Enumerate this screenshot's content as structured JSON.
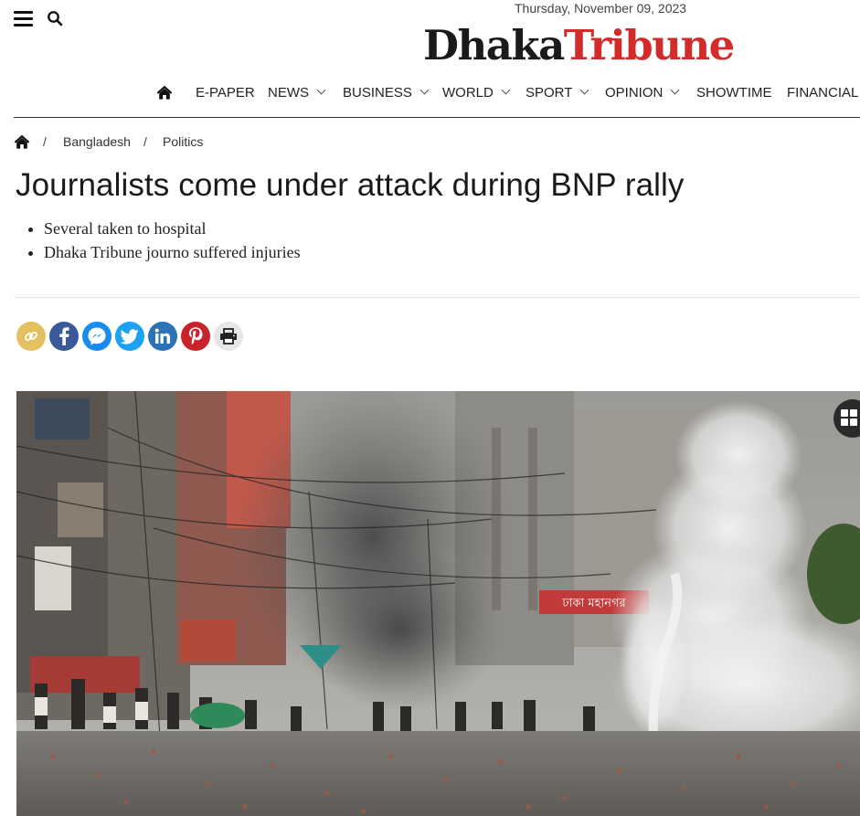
{
  "header": {
    "date": "Thursday, November 09, 2023",
    "logo_part1": "Dhaka",
    "logo_part2": "Tribune",
    "menu_icon": "hamburger-menu-icon",
    "search_icon": "search-icon"
  },
  "nav": {
    "home_icon": "home-icon",
    "items": [
      {
        "label": "E-PAPER",
        "dropdown": false
      },
      {
        "label": "NEWS",
        "dropdown": true
      },
      {
        "label": "BUSINESS",
        "dropdown": true
      },
      {
        "label": "WORLD",
        "dropdown": true
      },
      {
        "label": "SPORT",
        "dropdown": true
      },
      {
        "label": "OPINION",
        "dropdown": true
      },
      {
        "label": "SHOWTIME",
        "dropdown": false
      },
      {
        "label": "FINANCIAL",
        "dropdown": false
      }
    ]
  },
  "breadcrumb": {
    "separator": "/",
    "items": [
      "Bangladesh",
      "Politics"
    ]
  },
  "article": {
    "headline": "Journalists come under attack during BNP rally",
    "highlights": [
      "Several taken to hospital",
      "Dhaka Tribune journo suffered injuries"
    ]
  },
  "share": {
    "buttons": [
      {
        "icon": "copy-link-icon",
        "color": "#e3c160"
      },
      {
        "icon": "facebook-icon",
        "color": "#3b5998"
      },
      {
        "icon": "messenger-icon",
        "color": "#1a8cf0"
      },
      {
        "icon": "twitter-icon",
        "color": "#1da1f2"
      },
      {
        "icon": "linkedin-icon",
        "color": "#2b73b6"
      },
      {
        "icon": "pinterest-icon",
        "color": "#c8232c"
      },
      {
        "icon": "print-icon",
        "color": "#e6e6e6"
      }
    ]
  },
  "hero": {
    "sign_text": "ঢাকা মহানগর",
    "gallery_icon": "gallery-grid-icon"
  },
  "colors": {
    "brand_red": "#d32a2a",
    "text_dark": "#1a1a1a"
  }
}
